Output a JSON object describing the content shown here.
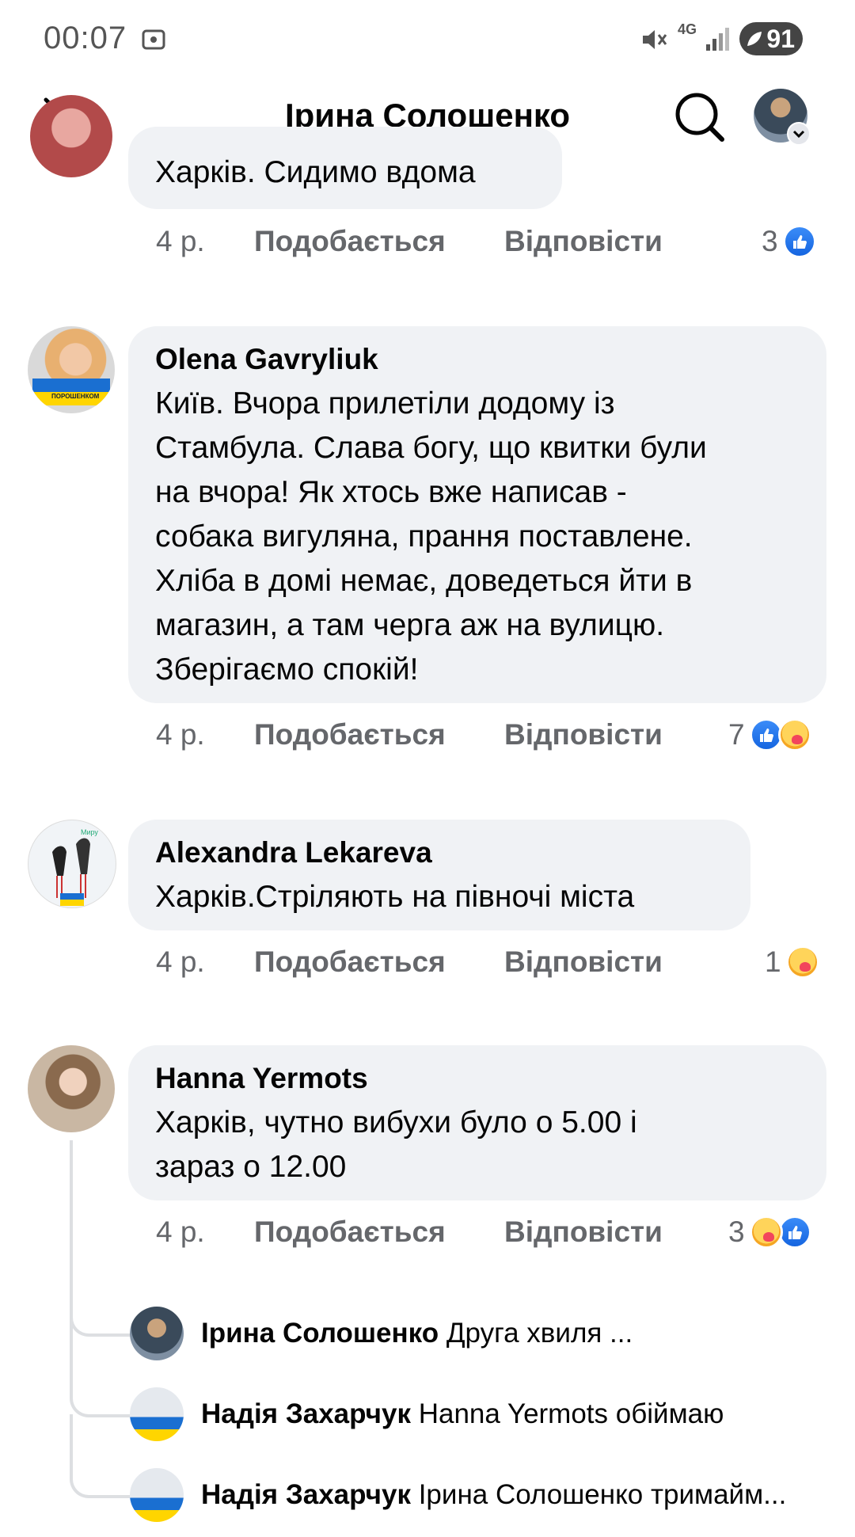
{
  "status_bar": {
    "time": "00:07",
    "network": "4G",
    "battery": "91"
  },
  "header": {
    "title": "Ірина Солошенко"
  },
  "comments": [
    {
      "name": "",
      "text": "Харків. Сидимо вдома",
      "time": "4 р.",
      "like_label": "Подобається",
      "reply_label": "Відповісти",
      "reaction_count": "3",
      "reactions": [
        "like-icon"
      ]
    },
    {
      "name": "Olena Gavryliuk",
      "text": "Київ. Вчора прилетіли додому із\nСтамбула. Слава богу, що квитки були\nна вчора! Як хтось вже написав -\nсобака вигуляна, прання поставлене.\nХліба в домі немає, доведеться йти в\nмагазин, а там черга аж на вулицю.\nЗберігаємо спокій!",
      "time": "4 р.",
      "like_label": "Подобається",
      "reply_label": "Відповісти",
      "reaction_count": "7",
      "reactions": [
        "like-icon",
        "care-icon"
      ],
      "avatar_badge": "ПОРОШЕНКОМ"
    },
    {
      "name": "Alexandra Lekareva",
      "text": "Харків.Стріляють на півночі міста",
      "time": "4 р.",
      "like_label": "Подобається",
      "reply_label": "Відповісти",
      "reaction_count": "1",
      "reactions": [
        "care-icon"
      ],
      "avatar_badge": "Миру"
    },
    {
      "name": "Hanna Yermots",
      "text": "Харків, чутно вибухи було о 5.00 і\nзараз о 12.00",
      "time": "4 р.",
      "like_label": "Подобається",
      "reply_label": "Відповісти",
      "reaction_count": "3",
      "reactions": [
        "care-icon",
        "like-icon"
      ]
    }
  ],
  "replies": [
    {
      "name": "Ірина Солошенко",
      "text": "Друга хвиля ..."
    },
    {
      "name": "Надія Захарчук",
      "text": "Hanna Yermots обіймаю"
    },
    {
      "name": "Надія Захарчук",
      "text": "Ірина Солошенко тримайм..."
    }
  ]
}
